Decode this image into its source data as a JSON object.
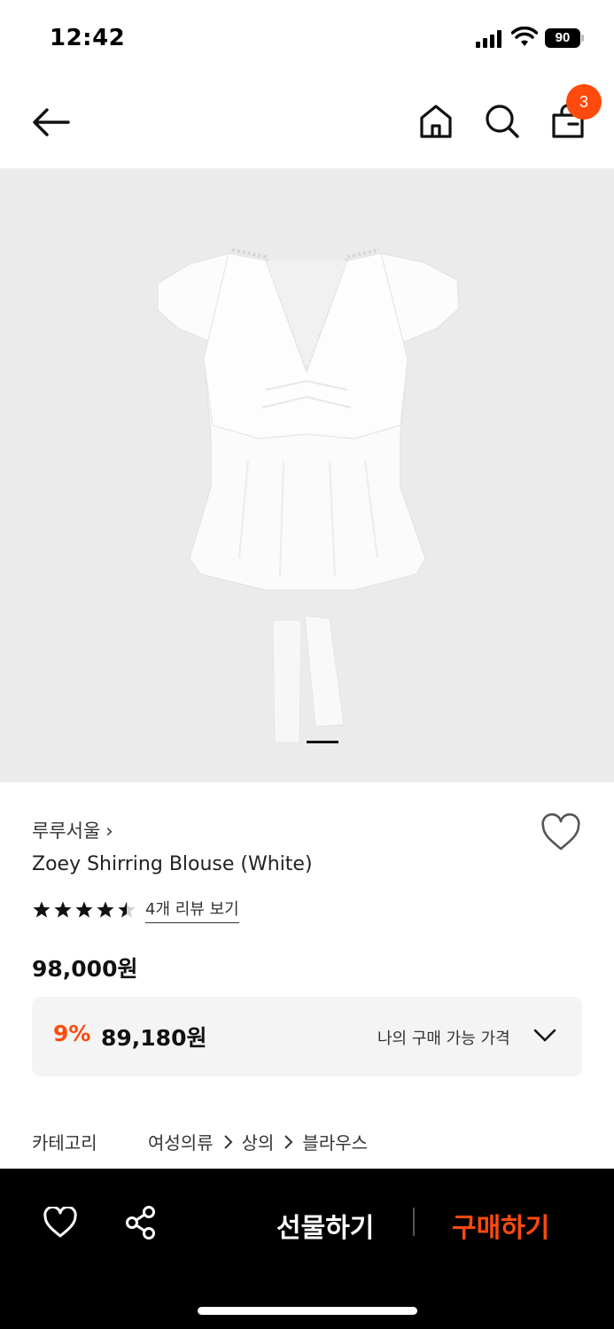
{
  "status_bar": {
    "time": "12:42",
    "battery": "90",
    "icons": [
      "signal-icon",
      "wifi-icon",
      "battery-icon"
    ]
  },
  "nav": {
    "icons": [
      "back-arrow-icon",
      "home-icon",
      "search-icon",
      "shopping-bag-icon"
    ],
    "cart_count": "3"
  },
  "product": {
    "image_indicator": "1",
    "brand": "루루서울",
    "name": "Zoey Shirring Blouse (White)",
    "rating": 4.5,
    "rating_max": 5,
    "review_link": "4개 리뷰 보기",
    "price_original": "98,000원",
    "discount_rate": "9%",
    "discount_price": "89,180원",
    "my_price_label": "나의 구매 가능 가격"
  },
  "category": {
    "label": "카테고리",
    "path": [
      "여성의류",
      "상의",
      "블라우스"
    ]
  },
  "bottom_bar": {
    "gift_label": "선물하기",
    "buy_label": "구매하기",
    "icons": [
      "heart-icon",
      "share-icon"
    ]
  },
  "colors": {
    "accent": "#ff4a0d",
    "bottom_bar_bg": "#000000",
    "image_bg": "#ebebeb",
    "price_box_bg": "#f4f4f4"
  }
}
